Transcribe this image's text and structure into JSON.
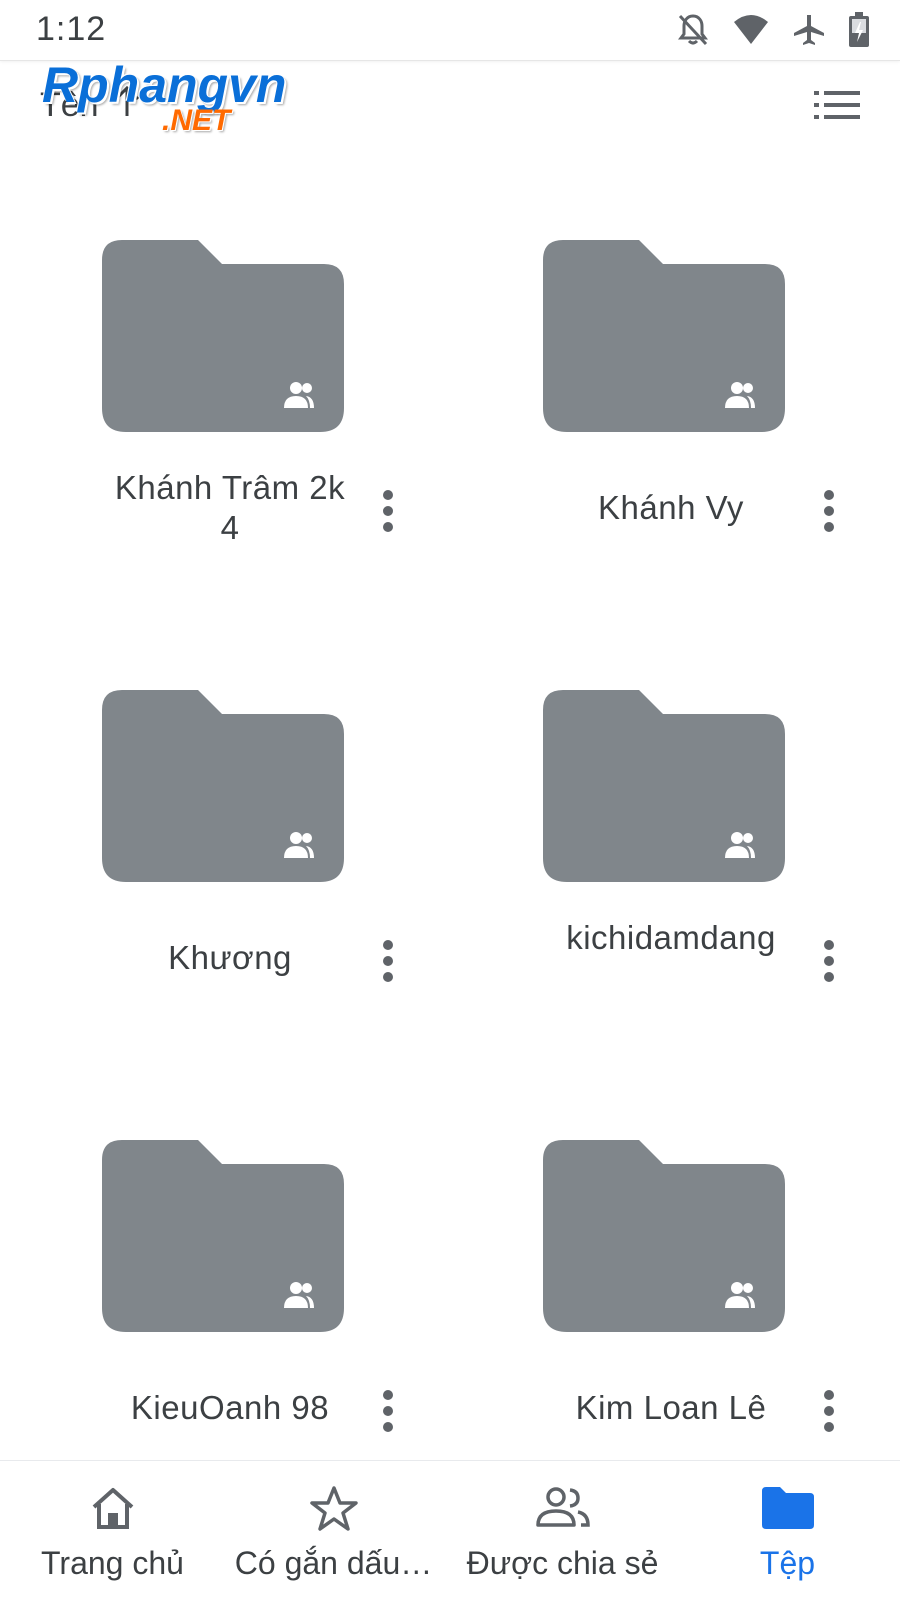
{
  "status_bar": {
    "time": "1:12",
    "icons": [
      "notifications-off-icon",
      "wifi-icon",
      "airplane-mode-icon",
      "battery-charging-icon"
    ]
  },
  "watermark": {
    "brand": "Rphangvn",
    "suffix": ".NET"
  },
  "sort_bar": {
    "label": "Tên",
    "direction_icon": "arrow-up-icon",
    "view_toggle_icon": "list-view-icon"
  },
  "colors": {
    "folder": "#80868b",
    "accent": "#1a73e8",
    "text": "#3c4043",
    "icon": "#5f6368"
  },
  "folders": [
    {
      "name": "Khánh Trâm 2k4",
      "shared": true
    },
    {
      "name": "Khánh Vy",
      "shared": true
    },
    {
      "name": "Khương",
      "shared": true
    },
    {
      "name": "kichidamdang",
      "shared": true
    },
    {
      "name": "KieuOanh 98",
      "shared": true
    },
    {
      "name": "Kim Loan Lê",
      "shared": true
    }
  ],
  "bottom_nav": [
    {
      "label": "Trang chủ",
      "icon": "home-icon",
      "active": false
    },
    {
      "label": "Có gắn dấu…",
      "icon": "star-icon",
      "active": false
    },
    {
      "label": "Được chia sẻ",
      "icon": "shared-people-icon",
      "active": false
    },
    {
      "label": "Tệp",
      "icon": "folder-icon",
      "active": true
    }
  ]
}
